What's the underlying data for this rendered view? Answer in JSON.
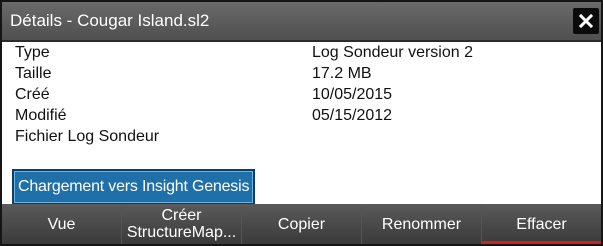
{
  "dialog": {
    "title": "Détails - Cougar Island.sl2",
    "close_icon": "close-icon"
  },
  "details": [
    {
      "label": "Type",
      "value": "Log Sondeur version 2"
    },
    {
      "label": "Taille",
      "value": "17.2 MB"
    },
    {
      "label": "Créé",
      "value": "10/05/2015"
    },
    {
      "label": "Modifié",
      "value": "05/15/2012"
    },
    {
      "label": "Fichier Log Sondeur",
      "value": ""
    }
  ],
  "upload_button": "Chargement vers Insight Genesis",
  "toolbar": {
    "view": "Vue",
    "create_structuremap_line1": "Créer",
    "create_structuremap_line2": "StructureMap...",
    "copy": "Copier",
    "rename": "Renommer",
    "delete": "Effacer"
  },
  "colors": {
    "active_indicator": "#d12020",
    "button_blue": "#1f6fa8"
  }
}
